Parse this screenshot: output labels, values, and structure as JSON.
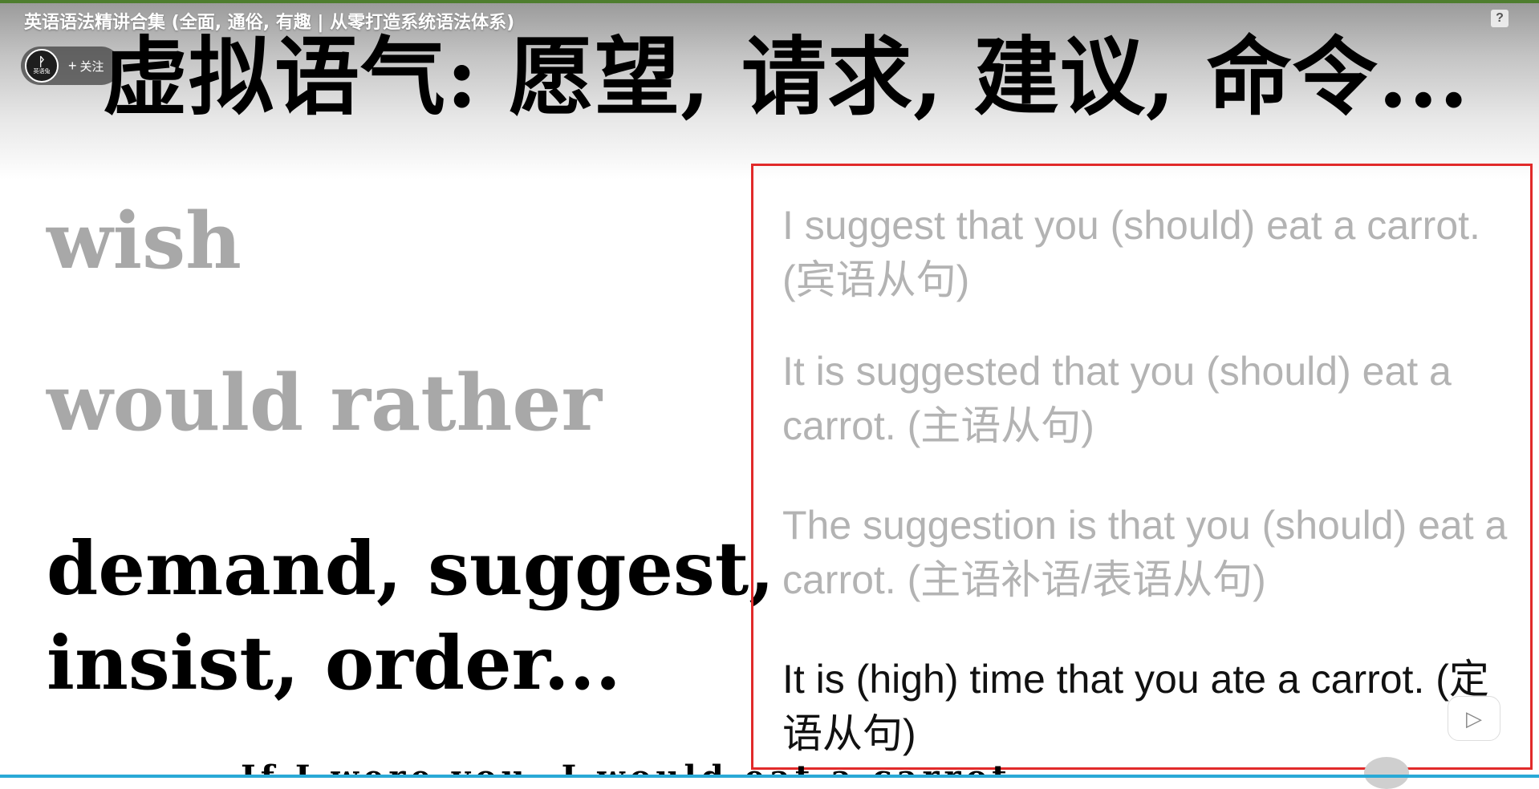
{
  "header": {
    "video_title": "英语语法精讲合集 (全面, 通俗, 有趣 | 从零打造系统语法体系)",
    "help_icon": "?",
    "follow": {
      "plus_icon": "+",
      "label": "关注",
      "avatar_logo_mark": "ᚹ",
      "avatar_logo_text": "英语兔"
    }
  },
  "slide": {
    "title": "虚拟语气: 愿望, 请求, 建议, 命令...",
    "left_terms": [
      "wish",
      "would rather",
      "demand, suggest,\ninsist, order..."
    ],
    "examples": [
      "I suggest that you (should) eat a carrot. (宾语从句)",
      "It is suggested that you (should) eat a carrot. (主语从句)",
      "The suggestion is that you (should) eat a carrot. (主语补语/表语从句)",
      "It is (high) time that you ate a carrot. (定语从句)"
    ],
    "bottom_cut_text": "If I were you, I would eat a carrot."
  },
  "colors": {
    "accent_border": "#e12a2a",
    "muted_text": "#a8a8a8",
    "progress_line": "#2aa9d6"
  }
}
